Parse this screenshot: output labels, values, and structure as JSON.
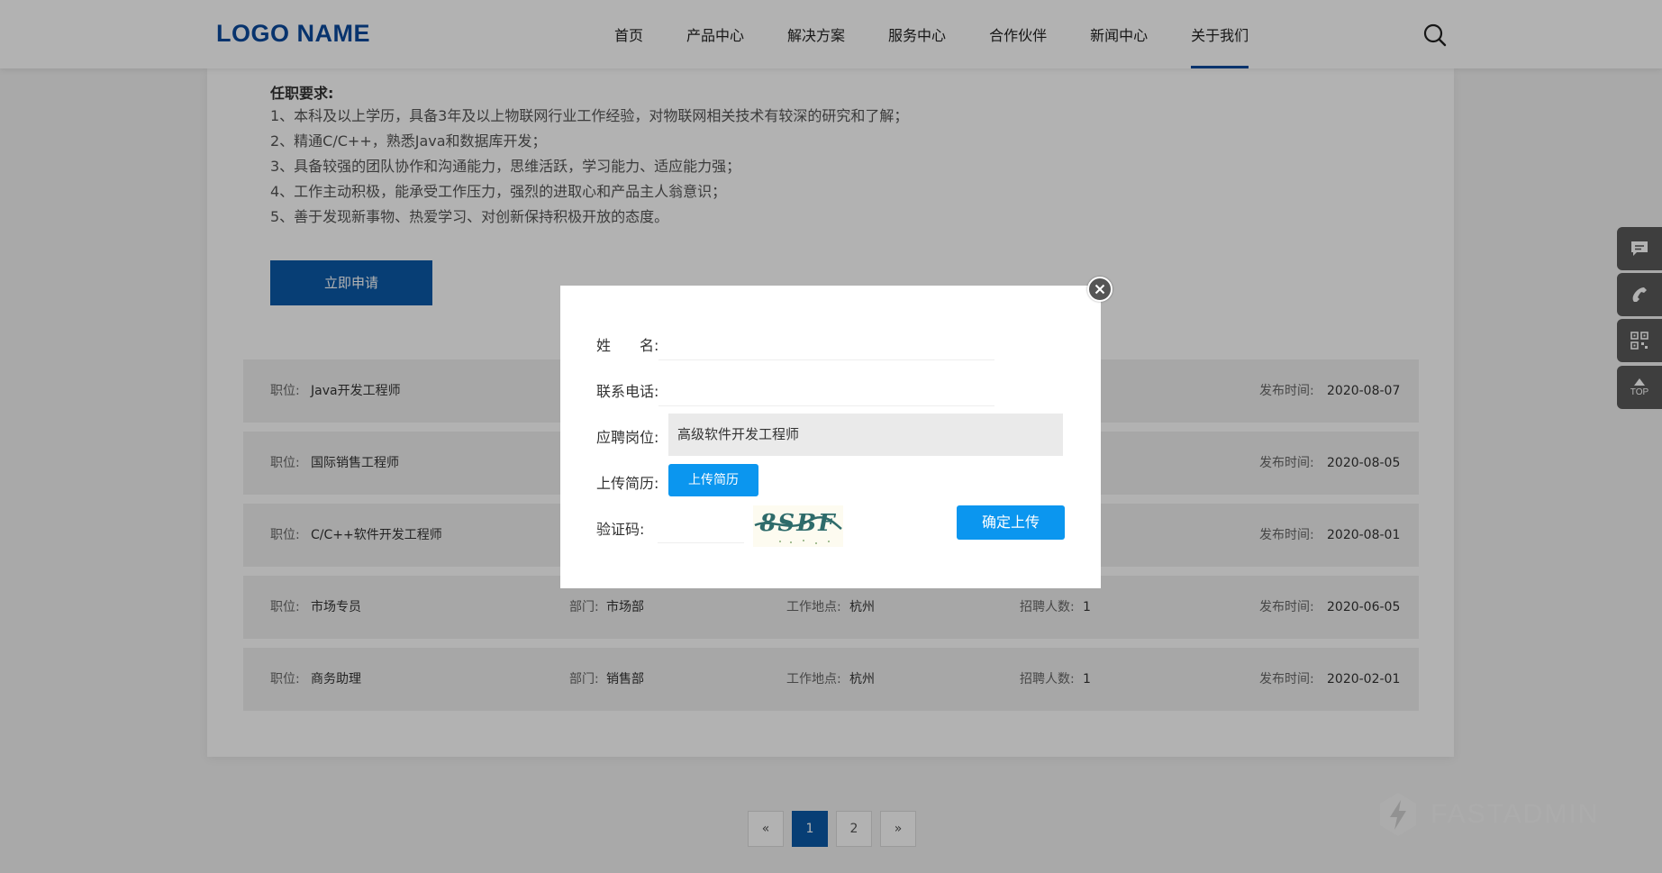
{
  "header": {
    "logo": "LOGO NAME",
    "nav": [
      "首页",
      "产品中心",
      "解决方案",
      "服务中心",
      "合作伙伴",
      "新闻中心",
      "关于我们"
    ],
    "active_nav": "关于我们",
    "search_icon": "search-icon"
  },
  "requirements": {
    "title": "任职要求:",
    "items": [
      "1、本科及以上学历，具备3年及以上物联网行业工作经验，对物联网相关技术有较深的研究和了解；",
      "2、精通C/C++，熟悉Java和数据库开发；",
      "3、具备较强的团队协作和沟通能力，思维活跃，学习能力、适应能力强；",
      "4、工作主动积极，能承受工作压力，强烈的进取心和产品主人翁意识；",
      "5、善于发现新事物、热爱学习、对创新保持积极开放的态度。"
    ],
    "apply_label": "立即申请"
  },
  "jobs": {
    "labels": {
      "position": "职位:",
      "department": "部门:",
      "location": "工作地点:",
      "headcount": "招聘人数:",
      "published": "发布时间:"
    },
    "rows": [
      {
        "position": "Java开发工程师",
        "department": "",
        "location": "",
        "headcount": "",
        "published": "2020-08-07"
      },
      {
        "position": "国际销售工程师",
        "department": "",
        "location": "",
        "headcount": "",
        "published": "2020-08-05"
      },
      {
        "position": "C/C++软件开发工程师",
        "department": "",
        "location": "",
        "headcount": "",
        "published": "2020-08-01"
      },
      {
        "position": "市场专员",
        "department": "市场部",
        "location": "杭州",
        "headcount": "1",
        "published": "2020-06-05"
      },
      {
        "position": "商务助理",
        "department": "销售部",
        "location": "杭州",
        "headcount": "1",
        "published": "2020-02-01"
      }
    ]
  },
  "pagination": {
    "prev": "«",
    "pages": [
      "1",
      "2"
    ],
    "current": "1",
    "next": "»"
  },
  "side_toolbar": {
    "items": [
      "message-icon",
      "phone-icon",
      "qrcode-icon",
      "back-to-top-icon"
    ],
    "top_label": "TOP"
  },
  "watermark": {
    "text": "FASTADMIN"
  },
  "modal": {
    "name_label": "姓　　名:",
    "phone_label": "联系电话:",
    "position_label": "应聘岗位:",
    "position_value": "高级软件开发工程师",
    "resume_label": "上传简历:",
    "upload_button": "上传简历",
    "captcha_label": "验证码:",
    "captcha_text": "8SBF",
    "confirm_button": "确定上传",
    "name_value": "",
    "phone_value": "",
    "captcha_value": ""
  },
  "colors": {
    "brand": "#0b4a9c",
    "button_blue": "#0b96ef",
    "apply_blue": "#0b5aa8"
  }
}
